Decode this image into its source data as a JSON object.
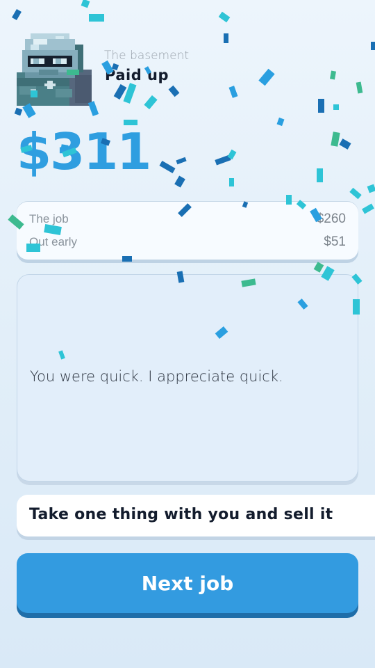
{
  "header": {
    "location": "The basement",
    "status": "Paid up",
    "avatar_icon": "diving-helmet-character-icon"
  },
  "payout": {
    "total": "$311",
    "items": [
      {
        "label": "The job",
        "amount": "$260"
      },
      {
        "label": "Out early",
        "amount": "$51"
      }
    ]
  },
  "dialogue": {
    "text": "You were quick. I appreciate quick."
  },
  "objective": {
    "text": "Take one thing with you and sell it"
  },
  "actions": {
    "next_label": "Next job"
  },
  "effects": {
    "confetti_colors": [
      "#2a9fe0",
      "#1a6fb3",
      "#2ec4d6",
      "#3dba8f"
    ]
  },
  "colors": {
    "accent": "#339be0",
    "total_text": "#2f9ee0",
    "dark_text": "#131c2d"
  }
}
